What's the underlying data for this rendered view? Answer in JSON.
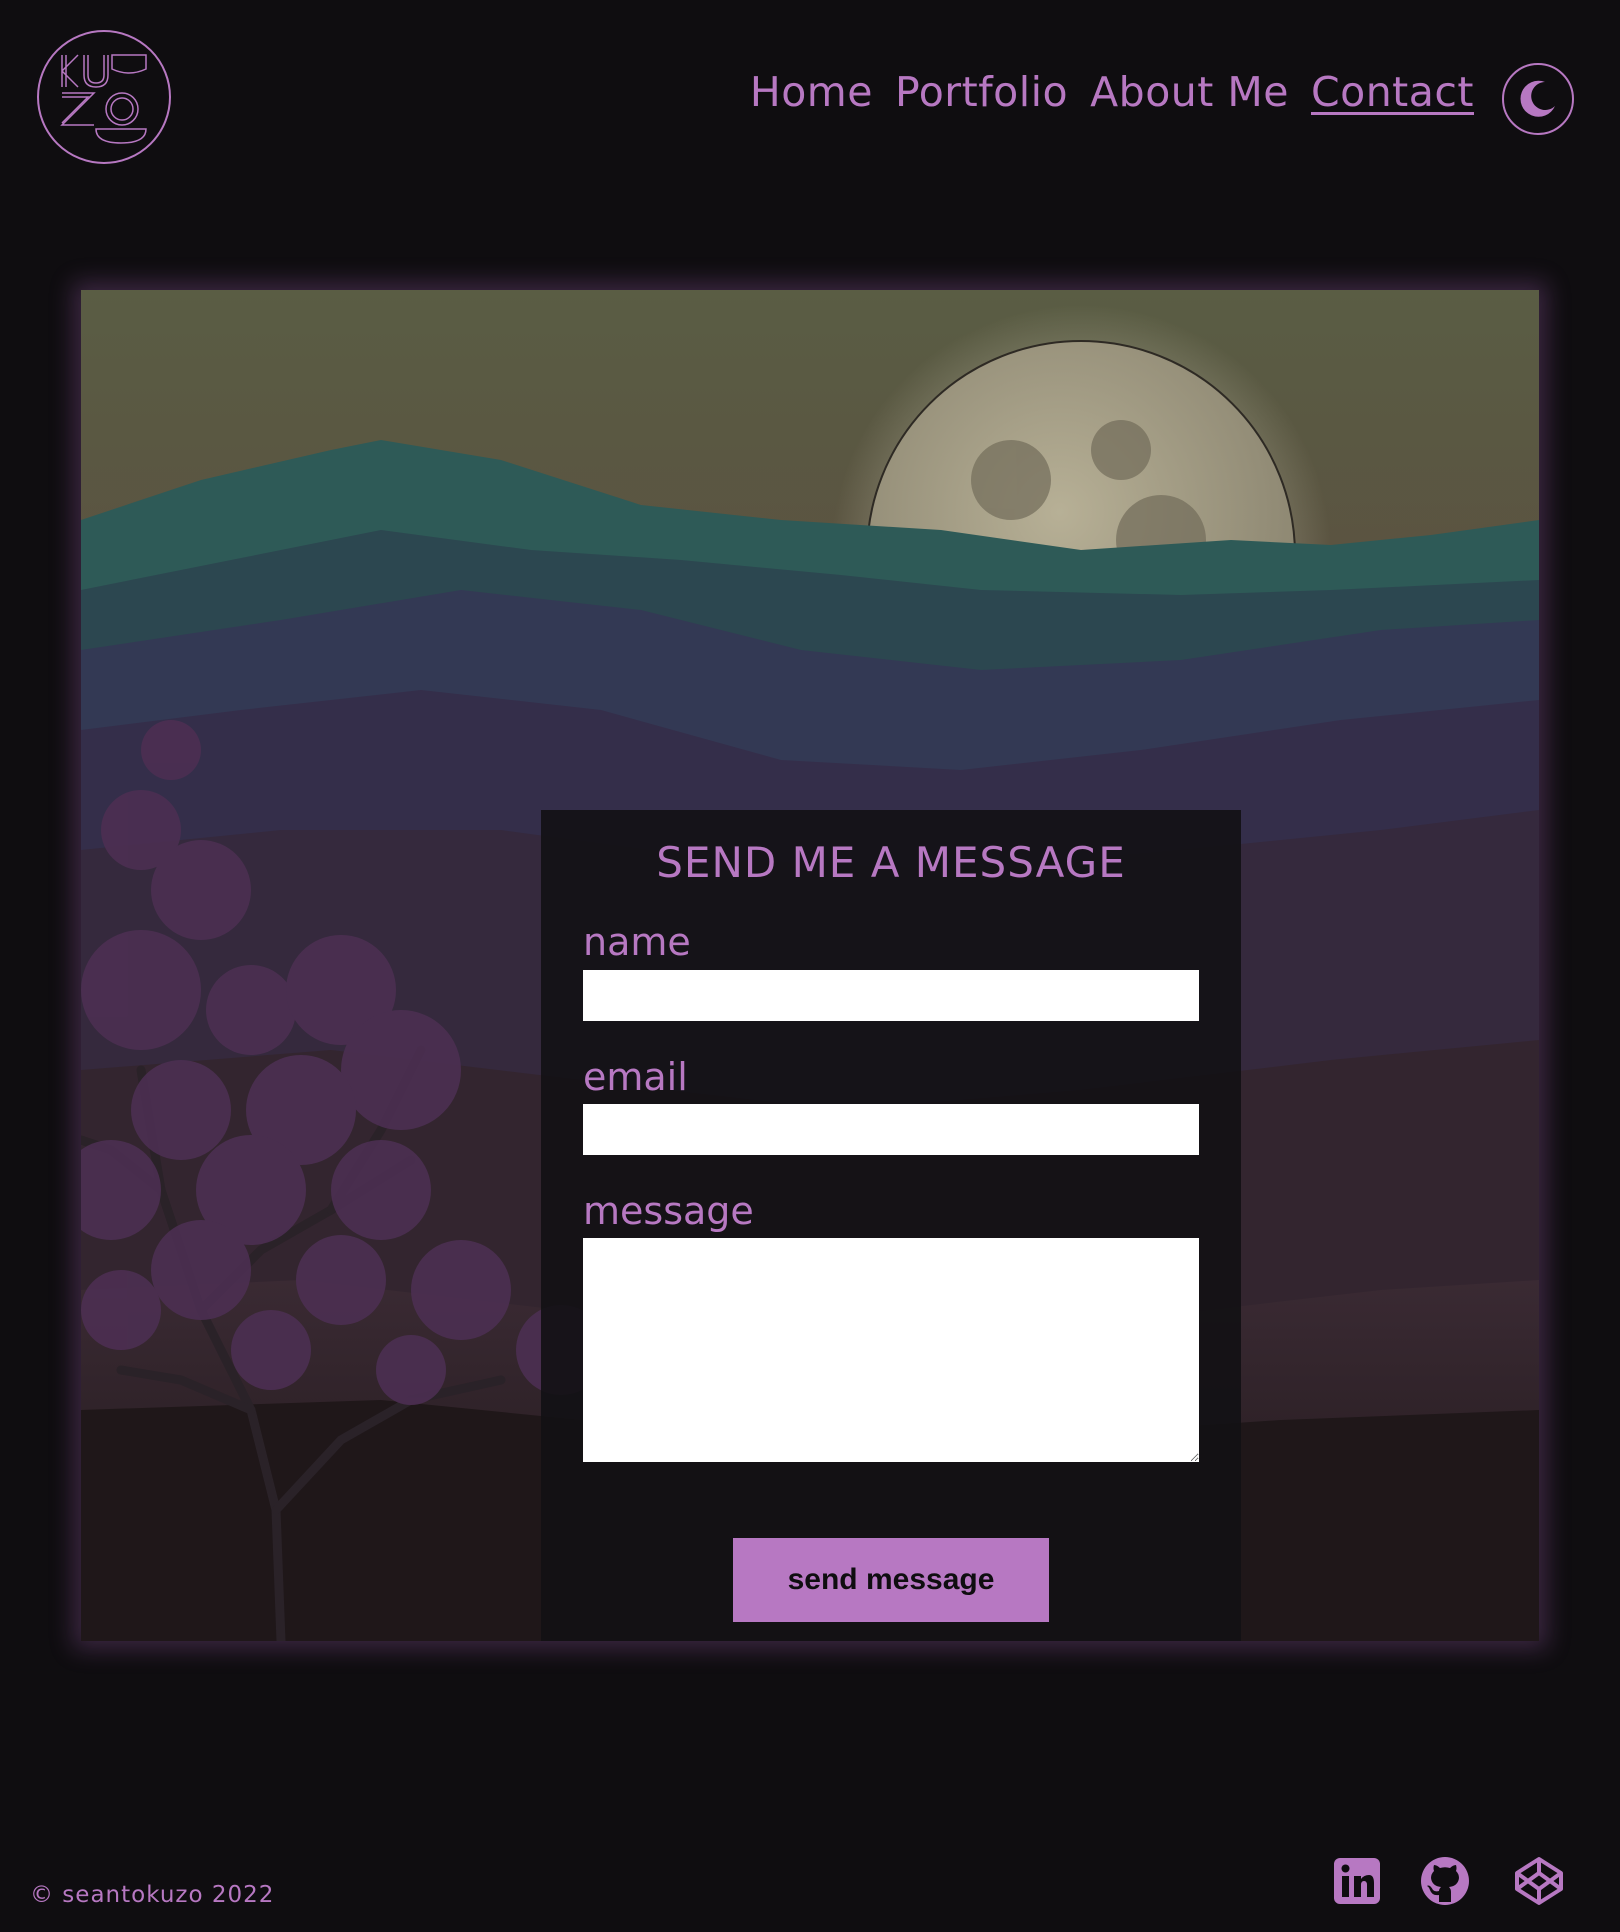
{
  "header": {
    "logo_text": "KUZO",
    "nav": [
      {
        "label": "Home",
        "active": false
      },
      {
        "label": "Portfolio",
        "active": false
      },
      {
        "label": "About Me",
        "active": false
      },
      {
        "label": "Contact",
        "active": true
      }
    ],
    "theme_toggle_icon": "moon-icon"
  },
  "contact_form": {
    "title": "SEND ME A MESSAGE",
    "name_label": "name",
    "name_value": "",
    "email_label": "email",
    "email_value": "",
    "message_label": "message",
    "message_value": "",
    "submit_label": "send message"
  },
  "footer": {
    "copyright": "© seantokuzo 2022",
    "social_icons": [
      "linkedin-icon",
      "github-icon",
      "codepen-icon"
    ]
  },
  "colors": {
    "background": "#0f0d10",
    "accent": "#b778c2",
    "panel": "#121114",
    "input_bg": "#ffffff"
  }
}
